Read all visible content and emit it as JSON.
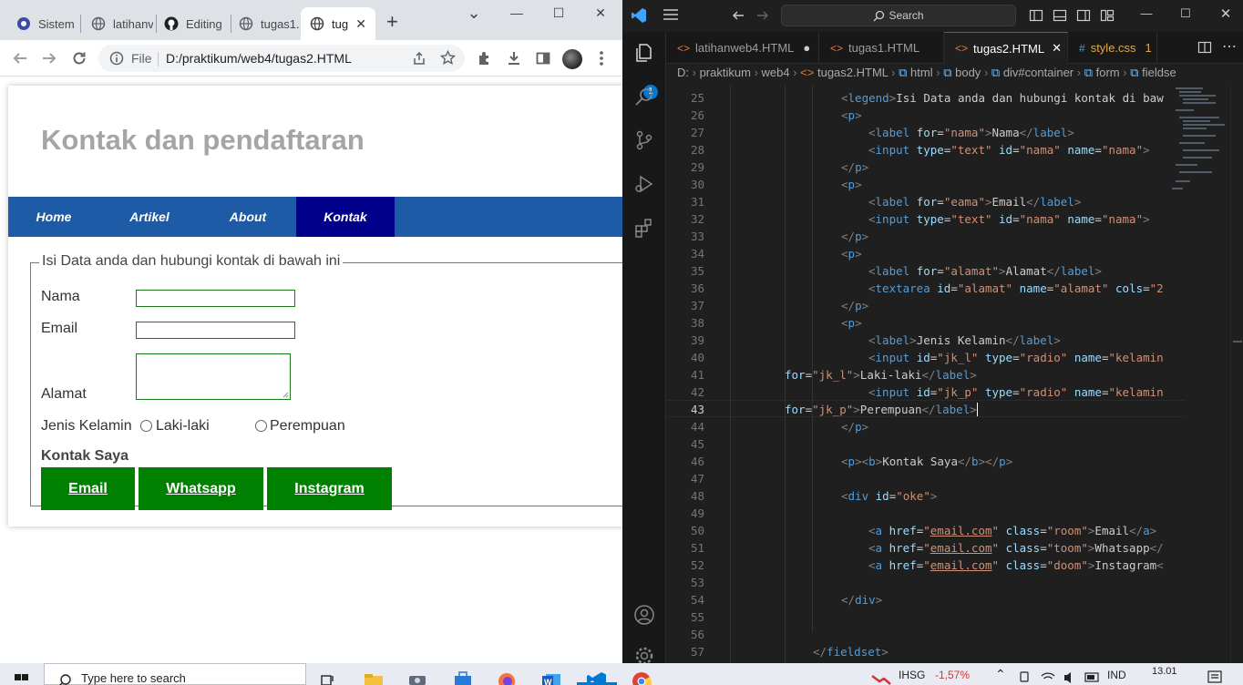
{
  "browser": {
    "tabs": [
      {
        "label": "Sistem I",
        "icon": "site-icon",
        "active": false
      },
      {
        "label": "latihanv",
        "icon": "globe-icon",
        "active": false
      },
      {
        "label": "Editing",
        "icon": "github-icon",
        "active": false
      },
      {
        "label": "tugas1.",
        "icon": "globe-icon",
        "active": false
      },
      {
        "label": "tug",
        "icon": "globe-icon",
        "active": true
      }
    ],
    "new_tab_symbol": "+",
    "window_minimize": "—",
    "window_maximize": "☐",
    "window_close": "✕",
    "tab_close": "✕",
    "tab_dropdown": "⌄",
    "omnibox": {
      "scheme_label": "File",
      "url": "D:/praktikum/web4/tugas2.HTML"
    }
  },
  "page": {
    "title": "Kontak dan pendaftaran",
    "nav": [
      {
        "label": "Home",
        "active": false
      },
      {
        "label": "Artikel",
        "active": false
      },
      {
        "label": "About",
        "active": false
      },
      {
        "label": "Kontak",
        "active": true
      }
    ],
    "legend": "Isi Data anda dan hubungi kontak di bawah ini",
    "form": {
      "nama_label": "Nama",
      "email_label": "Email",
      "alamat_label": "Alamat",
      "gender_label": "Jenis Kelamin",
      "gender_options": [
        "Laki-laki",
        "Perempuan"
      ]
    },
    "kontak_heading": "Kontak Saya",
    "contact_buttons": [
      "Email",
      "Whatsapp",
      "Instagram"
    ]
  },
  "vscode": {
    "search_placeholder": "Search",
    "tabs": [
      {
        "label": "latihanweb4.HTML",
        "icon": "<>",
        "status": "●"
      },
      {
        "label": "tugas1.HTML",
        "icon": "<>",
        "status": ""
      },
      {
        "label": "tugas2.HTML",
        "icon": "<>",
        "status": "✕"
      },
      {
        "label": "style.css",
        "icon": "#",
        "status": "1"
      }
    ],
    "explorer_badge": "1",
    "breadcrumbs": [
      "D:",
      "praktikum",
      "web4",
      "tugas2.HTML",
      "html",
      "body",
      "div#container",
      "form",
      "fieldse"
    ],
    "current_line": "43"
  },
  "taskbar": {
    "search_placeholder": "Type here to search",
    "stock_label": "IHSG",
    "stock_change": "-1,57%",
    "language": "IND",
    "time": "13.01"
  },
  "colors": {
    "nav_bg": "#1e5ba6",
    "nav_active": "#00008b",
    "button_green": "#008000",
    "title_gray": "#a5a5a5",
    "vscode_bg": "#1f1f1f",
    "accent_blue": "#0078d4",
    "stock_red": "#d13438"
  }
}
